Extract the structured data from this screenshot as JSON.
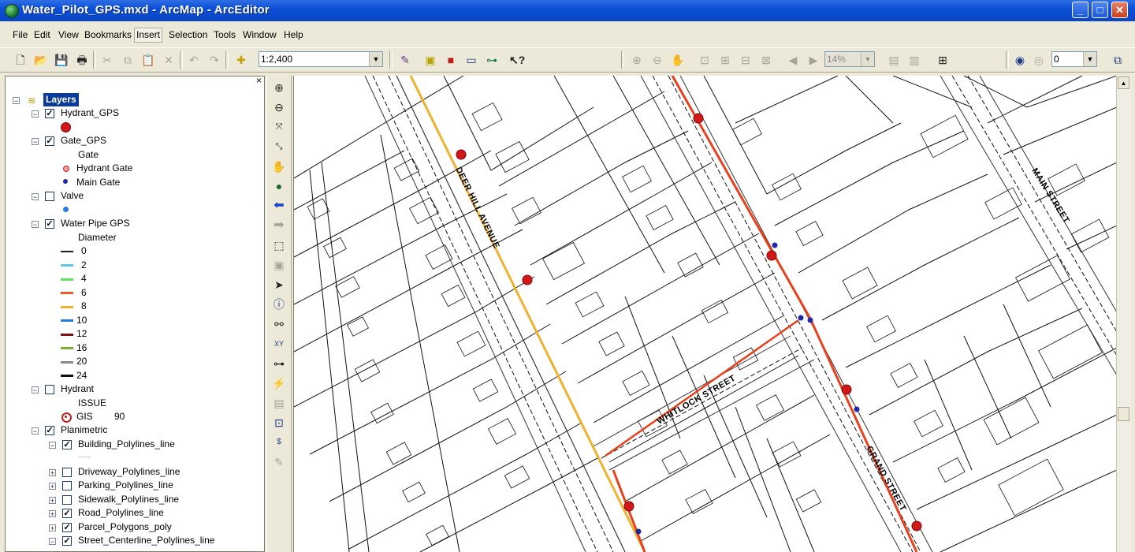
{
  "window": {
    "title": "Water_Pilot_GPS.mxd - ArcMap - ArcEditor",
    "minimize": "_",
    "maximize": "□",
    "close": "✕"
  },
  "menu": [
    "File",
    "Edit",
    "View",
    "Bookmarks",
    "Insert",
    "Selection",
    "Tools",
    "Window",
    "Help"
  ],
  "toolbar": {
    "scale_value": "1:2,400",
    "zoom_percent": "14%",
    "layer_value": "0",
    "icons": [
      "new-document-icon",
      "open-folder-icon",
      "save-icon",
      "print-icon",
      "cut-icon",
      "copy-icon",
      "paste-icon",
      "delete-icon",
      "undo-icon",
      "redo-icon",
      "add-data-icon",
      "editor-toolbar-icon",
      "arccatalog-icon",
      "arctoolbox-icon",
      "command-line-icon",
      "model-builder-icon",
      "whats-this-icon"
    ]
  },
  "toc": {
    "close": "×",
    "root": "Layers",
    "layers": [
      {
        "label": "Hydrant_GPS",
        "checked": true
      },
      {
        "label": "Gate_GPS",
        "checked": true,
        "heading": "Gate",
        "classes": [
          "Hydrant Gate",
          "Main Gate"
        ]
      },
      {
        "label": "Valve",
        "checked": false
      },
      {
        "label": "Water Pipe GPS",
        "checked": true,
        "heading": "Diameter",
        "classes": [
          {
            "label": "0",
            "color": "#1a1a1a"
          },
          {
            "label": "2",
            "color": "#5ac8e8"
          },
          {
            "label": "4",
            "color": "#5fe05f"
          },
          {
            "label": "6",
            "color": "#f05a28"
          },
          {
            "label": "8",
            "color": "#f0b030"
          },
          {
            "label": "10",
            "color": "#2a7be0"
          },
          {
            "label": "12",
            "color": "#7a1010"
          },
          {
            "label": "16",
            "color": "#7ab02a"
          },
          {
            "label": "20",
            "color": "#8a8a8a"
          },
          {
            "label": "24",
            "color": "#111111"
          }
        ]
      },
      {
        "label": "Hydrant",
        "checked": false,
        "heading": "ISSUE",
        "class_label": "GIS",
        "class_value": "90"
      },
      {
        "label": "Planimetric",
        "checked": true,
        "sublayers": [
          {
            "label": "Building_Polylines_line",
            "checked": true
          },
          {
            "label": "Driveway_Polylines_line",
            "checked": false
          },
          {
            "label": "Parking_Polylines_line",
            "checked": false
          },
          {
            "label": "Sidewalk_Polylines_line",
            "checked": false
          },
          {
            "label": "Road_Polylines_line",
            "checked": true
          },
          {
            "label": "Parcel_Polygons_poly",
            "checked": true
          },
          {
            "label": "Street_Centerline_Polylines_line",
            "checked": true
          }
        ]
      }
    ]
  },
  "map": {
    "streets": [
      "DEER HILL AVENUE",
      "WHITLOCK STREET",
      "GRAND STREET",
      "MAIN STREET"
    ],
    "colors": {
      "pipe_orange": "#f0b030",
      "pipe_red": "#e8401c",
      "hydrant": "#d21818",
      "gate": "#1c2aa8"
    }
  }
}
